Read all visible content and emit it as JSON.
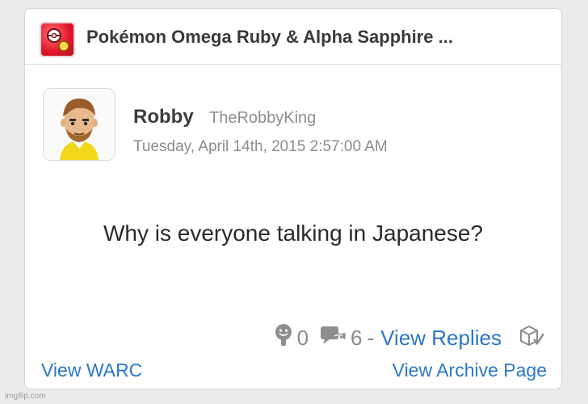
{
  "game": {
    "title": "Pokémon Omega Ruby & Alpha Sapphire ...",
    "icon": "pokeball-game-icon"
  },
  "post": {
    "author_name": "Robby",
    "author_id": "TheRobbyKing",
    "timestamp": "Tuesday, April 14th, 2015 2:57:00 AM",
    "text": "Why is everyone talking in Japanese?"
  },
  "stats": {
    "yeahs_icon": "yeah-face-icon",
    "yeahs": "0",
    "replies_icon": "reply-icon",
    "replies": "6",
    "separator": "-",
    "view_replies_label": "View Replies",
    "archive_icon": "archived-box-icon"
  },
  "links": {
    "view_warc": "View WARC",
    "view_archive_page": "View Archive Page"
  },
  "watermark": "imgflip.com",
  "colors": {
    "link": "#2b77c9",
    "muted": "#8d8d8d",
    "card": "#ffffff",
    "background": "#ececec"
  }
}
